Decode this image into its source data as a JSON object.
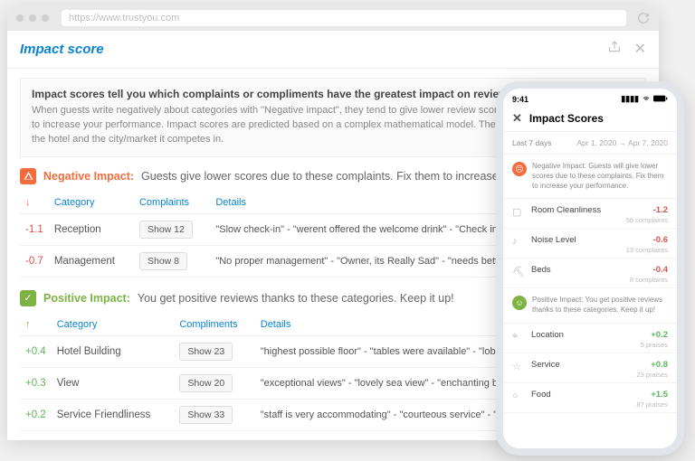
{
  "browser": {
    "url": "https://www.trustyou.com",
    "page_title": "Impact score",
    "intro_title": "Impact scores tell you which complaints or compliments have the greatest impact on review scores!",
    "intro_body": "When guests write negatively about categories with \"Negative impact\", they tend to give lower review scores. You should address these to increase your performance. Impact scores are predicted based on a complex mathematical model. They take into account the size of the hotel and the city/market it competes in."
  },
  "neg": {
    "label": "Negative Impact:",
    "desc": "Guests give lower scores due to these complaints. Fix them to increase your performance.",
    "cols": {
      "arrow": "↓",
      "category": "Category",
      "count": "Complaints",
      "details": "Details"
    },
    "rows": [
      {
        "score": "-1.1",
        "category": "Reception",
        "btn": "Show 12",
        "details": "\"Slow check-in\" - \"werent offered the welcome drink\" - \"Check in was a mess\""
      },
      {
        "score": "-0.7",
        "category": "Management",
        "btn": "Show 8",
        "details": "\"No proper management\" - \"Owner, its Really Sad\" - \"needs better management\""
      }
    ]
  },
  "pos": {
    "label": "Positive Impact:",
    "desc": "You get positive reviews thanks to these categories. Keep it up!",
    "cols": {
      "arrow": "↑",
      "category": "Category",
      "count": "Compliments",
      "details": "Details"
    },
    "rows": [
      {
        "score": "+0.4",
        "category": "Hotel Building",
        "btn": "Show 23",
        "details": "\"highest possible floor\" - \"tables were available\" - \"lobby was clean\""
      },
      {
        "score": "+0.3",
        "category": "View",
        "btn": "Show 20",
        "details": "\"exceptional views\" - \"lovely sea view\" - \"enchanting breathtaking view\""
      },
      {
        "score": "+0.2",
        "category": "Service Friendliness",
        "btn": "Show 33",
        "details": "\"staff is very accommodating\" - \"courteous service\" - \"staff is very helpful\""
      }
    ]
  },
  "phone": {
    "time": "9:41",
    "title": "Impact Scores",
    "range_label": "Last 7 days",
    "range_value": "Apr 1, 2020 → Apr 7, 2020",
    "neg_banner": "Negative Impact: Guests will give lower scores due to these complaints. Fix them to increase your performance.",
    "neg_banner_label": "Negative Impact:",
    "pos_banner": "Positive Impact: You get positive reviews thanks to these categories. Keep it up!",
    "pos_banner_label": "Positive Impact:",
    "neg_items": [
      {
        "icon": "▢",
        "cat": "Room Cleanliness",
        "score": "-1.2",
        "sub": "56 complaints"
      },
      {
        "icon": "♪",
        "cat": "Noise Level",
        "score": "-0.6",
        "sub": "13 complaints"
      },
      {
        "icon": "⛏",
        "cat": "Beds",
        "score": "-0.4",
        "sub": "8 complaints"
      }
    ],
    "pos_items": [
      {
        "icon": "⌖",
        "cat": "Location",
        "score": "+0.2",
        "sub": "5 praises"
      },
      {
        "icon": "☆",
        "cat": "Service",
        "score": "+0.8",
        "sub": "23 praises"
      },
      {
        "icon": "○",
        "cat": "Food",
        "score": "+1.5",
        "sub": "87 praises"
      }
    ]
  }
}
